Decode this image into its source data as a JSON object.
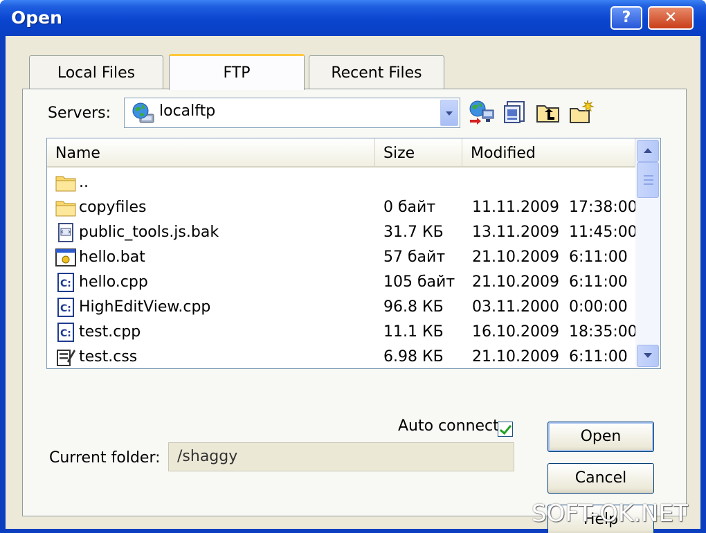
{
  "window": {
    "title": "Open",
    "help_label": "?",
    "close_label": "✕"
  },
  "tabs": [
    {
      "label": "Local Files"
    },
    {
      "label": "FTP"
    },
    {
      "label": "Recent Files"
    }
  ],
  "servers": {
    "label": "Servers:",
    "selected": "localftp"
  },
  "toolbar": {
    "icons": [
      "connect-icon",
      "properties-icon",
      "parent-folder-icon",
      "new-folder-icon"
    ]
  },
  "file_list": {
    "columns": [
      "Name",
      "Size",
      "Modified"
    ],
    "rows": [
      {
        "icon": "folder-icon",
        "name": "..",
        "size": "",
        "modified": ""
      },
      {
        "icon": "folder-icon",
        "name": "copyfiles",
        "size": "0 байт",
        "modified": "11.11.2009  17:38:00"
      },
      {
        "icon": "script-file-icon",
        "name": "public_tools.js.bak",
        "size": "31.7 КБ",
        "modified": "13.11.2009  11:45:00"
      },
      {
        "icon": "batch-file-icon",
        "name": "hello.bat",
        "size": "57 байт",
        "modified": "21.10.2009  6:11:00"
      },
      {
        "icon": "cpp-file-icon",
        "name": "hello.cpp",
        "size": "105 байт",
        "modified": "21.10.2009  6:11:00"
      },
      {
        "icon": "cpp-file-icon",
        "name": "HighEditView.cpp",
        "size": "96.8 КБ",
        "modified": "03.11.2000  0:00:00"
      },
      {
        "icon": "cpp-file-icon",
        "name": "test.cpp",
        "size": "11.1 КБ",
        "modified": "16.10.2009  18:35:00"
      },
      {
        "icon": "css-file-icon",
        "name": "test.css",
        "size": "6.98 КБ",
        "modified": "21.10.2009  6:11:00"
      }
    ]
  },
  "auto_connect": {
    "label": "Auto connect",
    "checked": true
  },
  "current_folder": {
    "label": "Current folder:",
    "value": "/shaggy"
  },
  "buttons": {
    "open": "Open",
    "cancel": "Cancel",
    "help": "Help"
  },
  "watermark": {
    "text": "SOFT-OK.NET"
  }
}
